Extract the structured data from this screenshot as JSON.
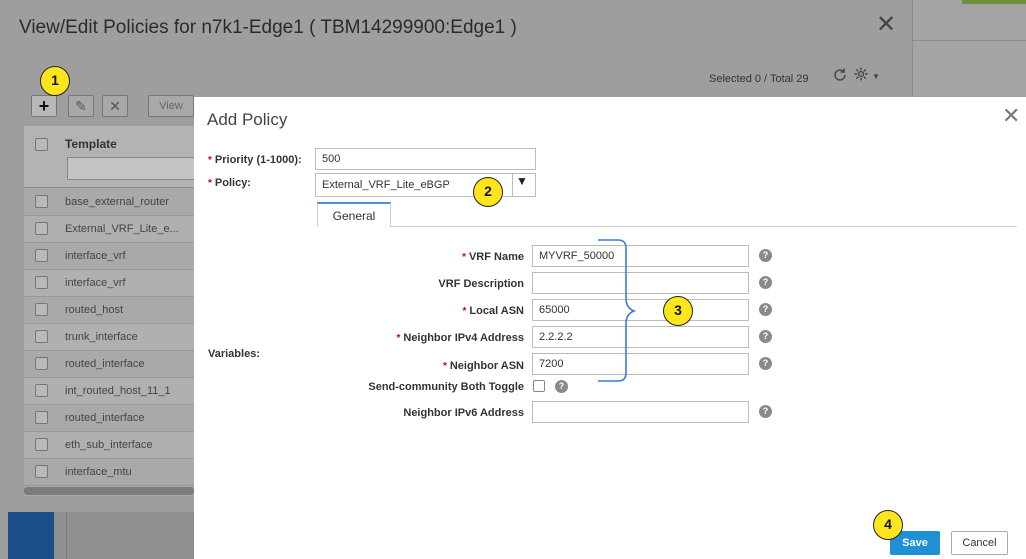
{
  "background": {
    "title": "View/Edit Policies for n7k1-Edge1 ( TBM14299900:Edge1 )",
    "close_glyph": "✕",
    "selected_total": "Selected 0 / Total 29",
    "toolbar": {
      "add": "+",
      "edit": "✎",
      "delete": "✕",
      "view": "View"
    },
    "table": {
      "column_template": "Template",
      "rows": [
        "base_external_router",
        "External_VRF_Lite_e...",
        "interface_vrf",
        "interface_vrf",
        "routed_host",
        "trunk_interface",
        "routed_interface",
        "int_routed_host_11_1",
        "routed_interface",
        "eth_sub_interface",
        "interface_mtu"
      ]
    }
  },
  "dialog": {
    "title": "Add Policy",
    "close_glyph": "✕",
    "required_mark": "*",
    "priority": {
      "label": "Priority (1-1000):",
      "value": "500"
    },
    "policy": {
      "label": "Policy:",
      "value": "External_VRF_Lite_eBGP",
      "arrow": "▼"
    },
    "tabs": [
      "General"
    ],
    "variables_label": "Variables:",
    "fields": {
      "vrf_name": {
        "label": "VRF Name",
        "value": "MYVRF_50000",
        "required": true
      },
      "vrf_description": {
        "label": "VRF Description",
        "value": "",
        "required": false
      },
      "local_asn": {
        "label": "Local ASN",
        "value": "65000",
        "required": true
      },
      "neighbor_ipv4": {
        "label": "Neighbor IPv4 Address",
        "value": "2.2.2.2",
        "required": true
      },
      "neighbor_asn": {
        "label": "Neighbor ASN",
        "value": "7200",
        "required": true
      },
      "send_community": {
        "label": "Send-community Both Toggle",
        "checked": false
      },
      "neighbor_ipv6": {
        "label": "Neighbor IPv6 Address",
        "value": "",
        "required": false
      }
    },
    "help_glyph": "?",
    "save_label": "Save",
    "cancel_label": "Cancel"
  },
  "callouts": [
    "1",
    "2",
    "3",
    "4"
  ],
  "colors": {
    "primary_button": "#1f8fd6",
    "callout_fill": "#ffe51c",
    "required": "#d0021b",
    "tab_accent": "#4a90d9",
    "bracket": "#3a7bd5"
  }
}
